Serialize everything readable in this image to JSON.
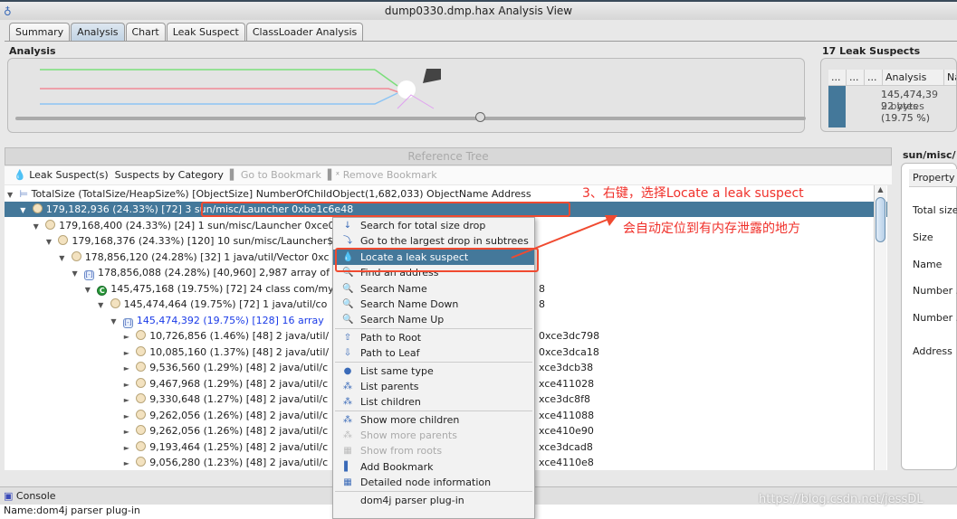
{
  "window": {
    "title": "dump0330.dmp.hax Analysis View"
  },
  "tabs": [
    {
      "label": "Summary"
    },
    {
      "label": "Analysis",
      "active": true
    },
    {
      "label": "Chart"
    },
    {
      "label": "Leak Suspect"
    },
    {
      "label": "ClassLoader Analysis"
    }
  ],
  "analysis": {
    "title": "Analysis"
  },
  "leak_suspects": {
    "title": "17 Leak Suspects",
    "columns": [
      "...",
      "...",
      "...",
      "Analysis",
      "Na"
    ],
    "cell": "145,474,392 bytes (19.75 %)",
    "cell_lines": [
      "145,474,3",
      "92 bytes",
      "(19.75 %)"
    ]
  },
  "reference_tree": {
    "title": "Reference Tree",
    "toolbar": {
      "leak_suspects": "Leak Suspect(s)",
      "by_category": "Suspects by Category",
      "goto_bookmark": "Go to Bookmark",
      "remove_bookmark": "Remove Bookmark"
    },
    "header": "TotalSize (TotalSize/HeapSize%) [ObjectSize] NumberOfChildObject(1,682,033) ObjectName Address",
    "rows": [
      {
        "text": "179,182,936 (24.33%) [72] 3 sun/misc/Launcher 0xbe1c6e48",
        "addr": "",
        "selected": true,
        "icon": "object"
      },
      {
        "text": "179,168,400 (24.33%) [24] 1 sun/misc/Launcher 0xce0",
        "addr": "",
        "icon": "object"
      },
      {
        "text": "179,168,376 (24.33%) [120] 10 sun/misc/Launcher$",
        "addr": "",
        "icon": "object"
      },
      {
        "text": "178,856,120 (24.28%) [32] 1 java/util/Vector 0xc",
        "addr": "",
        "icon": "object"
      },
      {
        "text": "178,856,088 (24.28%) [40,960] 2,987 array of",
        "addr": "",
        "icon": "array"
      },
      {
        "text": "145,475,168 (19.75%) [72] 24 class com/my",
        "addr": "8",
        "icon": "class"
      },
      {
        "text": "145,474,464 (19.75%) [72] 1 java/util/co",
        "addr": "8",
        "icon": "object"
      },
      {
        "text": "145,474,392 (19.75%) [128] 16 array",
        "addr": "",
        "icon": "array",
        "blue": true
      },
      {
        "text": "10,726,856 (1.46%) [48] 2 java/util/",
        "addr": "0xce3dc798",
        "icon": "object"
      },
      {
        "text": "10,085,160 (1.37%) [48] 2 java/util/",
        "addr": "0xce3dca18",
        "icon": "object"
      },
      {
        "text": "9,536,560 (1.29%) [48] 2 java/util/c",
        "addr": "xce3dcb38",
        "icon": "object"
      },
      {
        "text": "9,467,968 (1.29%) [48] 2 java/util/c",
        "addr": "xce411028",
        "icon": "object"
      },
      {
        "text": "9,330,648 (1.27%) [48] 2 java/util/c",
        "addr": "xce3dc8f8",
        "icon": "object"
      },
      {
        "text": "9,262,056 (1.26%) [48] 2 java/util/c",
        "addr": "xce411088",
        "icon": "object"
      },
      {
        "text": "9,262,056 (1.26%) [48] 2 java/util/c",
        "addr": "xce410e90",
        "icon": "object"
      },
      {
        "text": "9,193,464 (1.25%) [48] 2 java/util/c",
        "addr": "xce3dcad8",
        "icon": "object"
      },
      {
        "text": "9,056,280 (1.23%) [48] 2 java/util/c",
        "addr": "xce4110e8",
        "icon": "object"
      }
    ]
  },
  "properties": {
    "title": "sun/misc/",
    "header": "Property",
    "rows": [
      "Total size",
      "Size",
      "Name",
      "Number ...",
      "Number ...",
      "Address"
    ]
  },
  "context_menu": {
    "items": [
      {
        "label": "Search for total size drop",
        "icon": "arrow-down-icon",
        "glyph": "↓"
      },
      {
        "label": "Go to the largest drop in subtrees",
        "icon": "drop-arrow-icon",
        "glyph": "⤵"
      },
      {
        "label": "Locate a leak suspect",
        "icon": "drop-icon",
        "glyph": "💧",
        "highlighted": true
      },
      {
        "label": "Find an address",
        "icon": "search-icon",
        "glyph": "🔍"
      },
      {
        "label": "Search Name",
        "icon": "search-icon",
        "glyph": "🔍"
      },
      {
        "label": "Search Name Down",
        "icon": "search-down-icon",
        "glyph": "🔍"
      },
      {
        "label": "Search Name Up",
        "icon": "search-up-icon",
        "glyph": "🔍",
        "sep_after": true
      },
      {
        "label": "Path to Root",
        "icon": "arrow-up-icon",
        "glyph": "⇧"
      },
      {
        "label": "Path to Leaf",
        "icon": "arrow-down-icon",
        "glyph": "⇩",
        "sep_after": true
      },
      {
        "label": "List same type",
        "icon": "same-type-icon",
        "glyph": "●"
      },
      {
        "label": "List parents",
        "icon": "parents-icon",
        "glyph": "⁂"
      },
      {
        "label": "List children",
        "icon": "children-icon",
        "glyph": "⁂",
        "sep_after": true
      },
      {
        "label": "Show more children",
        "icon": "more-children-icon",
        "glyph": "⁂"
      },
      {
        "label": "Show more parents",
        "icon": "more-parents-icon",
        "glyph": "⁂",
        "disabled": true
      },
      {
        "label": "Show from roots",
        "icon": "roots-icon",
        "glyph": "▦",
        "disabled": true
      },
      {
        "label": "Add Bookmark",
        "icon": "bookmark-icon",
        "glyph": "▌"
      },
      {
        "label": "Detailed node information",
        "icon": "grid-icon",
        "glyph": "▦",
        "sep_after": true
      },
      {
        "label": "dom4j parser plug-in",
        "icon": "",
        "glyph": ""
      }
    ]
  },
  "console": {
    "title": "Console",
    "text": "Name:dom4j parser plug-in"
  },
  "annotations": {
    "step": "3、右键，选择Locate a leak suspect",
    "note": "会自动定位到有内存泄露的地方",
    "color": "#f0302a"
  },
  "watermark": "https://blog.csdn.net/jessDL"
}
